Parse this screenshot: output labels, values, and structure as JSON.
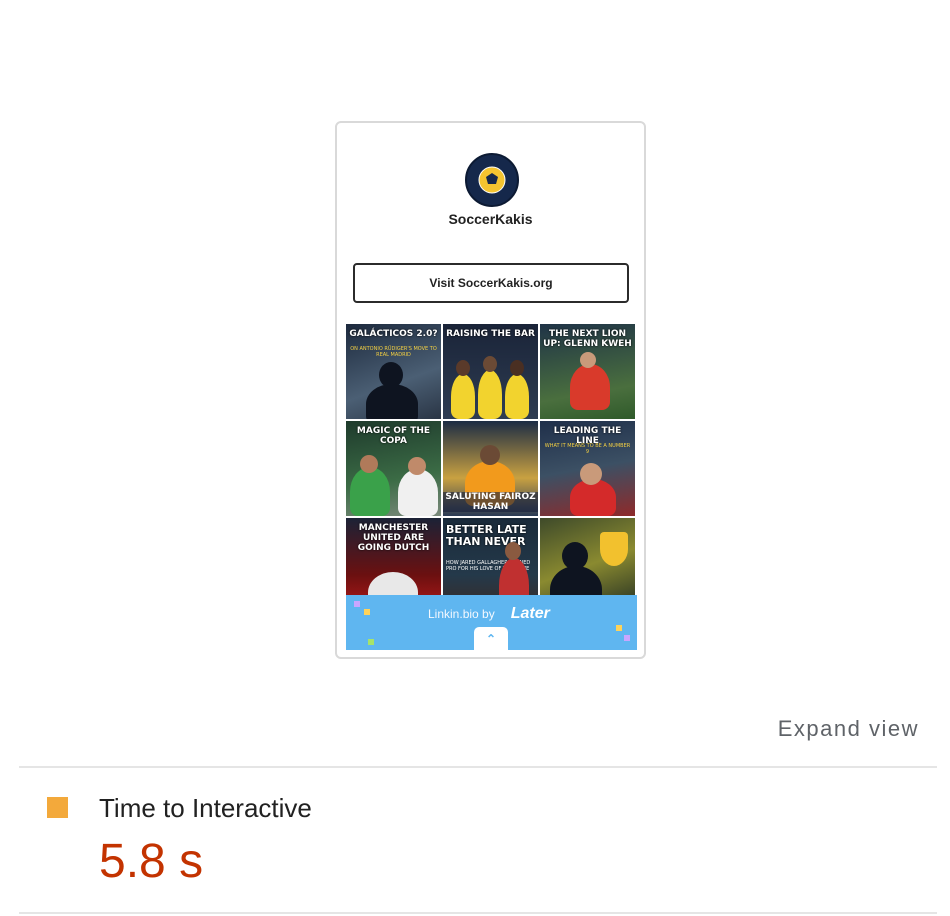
{
  "preview": {
    "profile_name": "SoccerKakis",
    "visit_button": "Visit SoccerKakis.org",
    "tiles": [
      {
        "title": "GALÁCTICOS 2.0?",
        "subtitle": "ON ANTONIO RÜDIGER'S MOVE TO REAL MADRID",
        "footer": ""
      },
      {
        "title": "RAISING THE BAR",
        "subtitle": "",
        "footer": ""
      },
      {
        "title": "THE NEXT LION UP: GLENN KWEH",
        "subtitle": "",
        "footer": ""
      },
      {
        "title": "MAGIC OF THE COPA",
        "subtitle": "",
        "footer": ""
      },
      {
        "title": "",
        "subtitle": "",
        "footer": "SALUTING FAIROZ HASAN"
      },
      {
        "title": "LEADING THE LINE",
        "subtitle": "WHAT IT MEANS TO BE A NUMBER 9",
        "footer": ""
      },
      {
        "title": "MANCHESTER UNITED ARE GOING DUTCH",
        "subtitle": "",
        "footer": ""
      },
      {
        "title": "BETTER LATE THAN NEVER",
        "subtitle": "HOW JARED GALLAGHER TURNED PRO FOR HIS LOVE OF THE GAME",
        "footer": ""
      },
      {
        "title": "",
        "subtitle": "",
        "footer": ""
      }
    ],
    "later": {
      "text": "Linkin.bio by",
      "logo": "Later",
      "color": "#5fb6f0"
    }
  },
  "expand_view": "Expand view",
  "metric": {
    "label": "Time to Interactive",
    "value": "5.8 s",
    "square_color": "#f3a93b",
    "value_color": "#c33300"
  }
}
